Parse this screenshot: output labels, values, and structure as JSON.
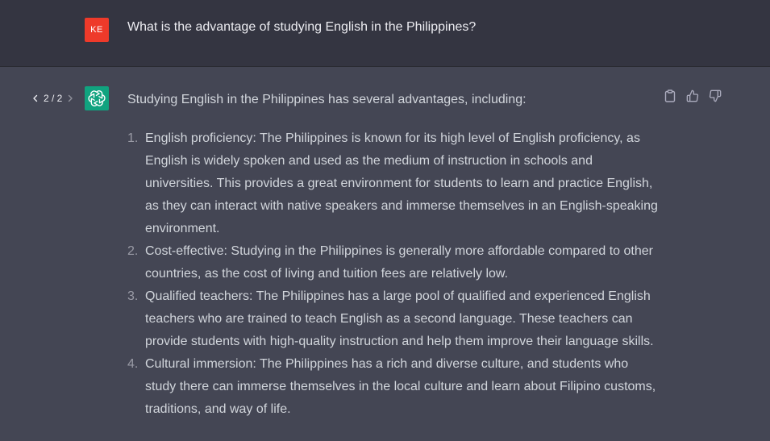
{
  "user": {
    "avatar_text": "KE",
    "message": "What is the advantage of studying English in the Philippines?"
  },
  "response": {
    "pager": "2 / 2",
    "intro": "Studying English in the Philippines has several advantages, including:",
    "items": [
      {
        "number": "1.",
        "text": "English proficiency: The Philippines is known for its high level of English proficiency, as English is widely spoken and used as the medium of instruction in schools and universities. This provides a great environment for students to learn and practice English, as they can interact with native speakers and immerse themselves in an English-speaking environment."
      },
      {
        "number": "2.",
        "text": "Cost-effective: Studying in the Philippines is generally more affordable compared to other countries, as the cost of living and tuition fees are relatively low."
      },
      {
        "number": "3.",
        "text": "Qualified teachers: The Philippines has a large pool of qualified and experienced English teachers who are trained to teach English as a second language. These teachers can provide students with high-quality instruction and help them improve their language skills."
      },
      {
        "number": "4.",
        "text": "Cultural immersion: The Philippines has a rich and diverse culture, and students who study there can immerse themselves in the local culture and learn about Filipino customs, traditions, and way of life."
      }
    ]
  },
  "icons": {
    "prev": "chevron-left-icon",
    "next": "chevron-right-icon",
    "assistant": "openai-logo-icon",
    "copy": "clipboard-icon",
    "like": "thumbs-up-icon",
    "dislike": "thumbs-down-icon"
  },
  "colors": {
    "user_bg": "#343541",
    "assistant_bg": "#444654",
    "user_avatar": "#ee3a2a",
    "assistant_avatar": "#10a37f"
  }
}
